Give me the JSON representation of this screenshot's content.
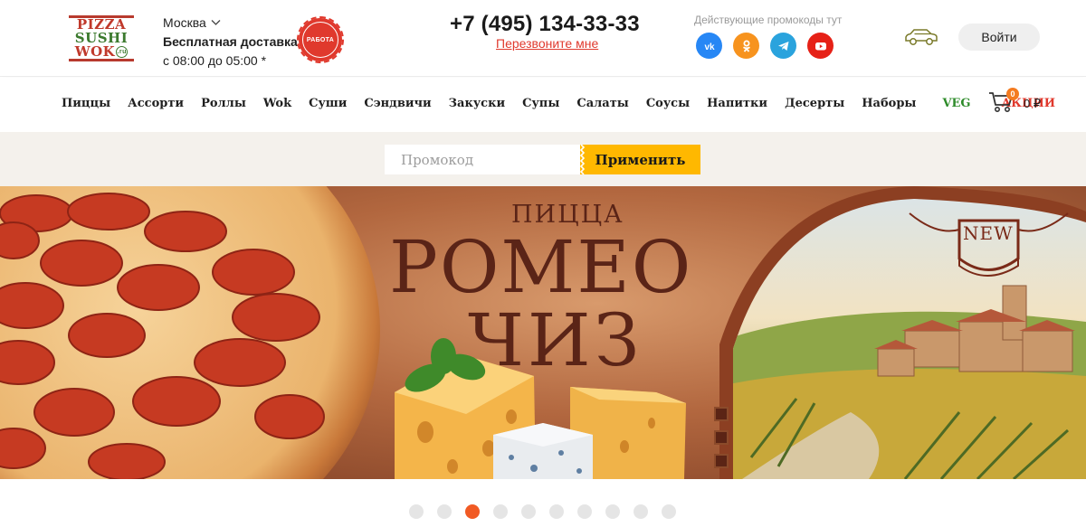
{
  "logo": {
    "line1": "PIZZA",
    "line2": "SUSHI",
    "line3": "WOK",
    "badge": ".ru"
  },
  "location": {
    "city": "Москва",
    "delivery": "Бесплатная доставка",
    "hours": "с 08:00 до 05:00 *"
  },
  "work_badge": "РАБОТА",
  "contact": {
    "phone": "+7 (495) 134-33-33",
    "callback": "Перезвоните мне"
  },
  "promo_note": "Действующие промокоды тут",
  "socials": [
    {
      "name": "vk-icon",
      "color": "#2787f5"
    },
    {
      "name": "ok-icon",
      "color": "#f7931e"
    },
    {
      "name": "telegram-icon",
      "color": "#2aa3dd"
    },
    {
      "name": "youtube-icon",
      "color": "#e62117"
    }
  ],
  "login_label": "Войти",
  "nav": {
    "items": [
      "Пиццы",
      "Ассорти",
      "Роллы",
      "Wok",
      "Суши",
      "Сэндвичи",
      "Закуски",
      "Супы",
      "Салаты",
      "Соусы",
      "Напитки",
      "Десерты",
      "Наборы",
      "VEG",
      "АКЦИИ"
    ],
    "veg_color": "#2e8b2a",
    "sale_color": "#e0392d"
  },
  "cart": {
    "count": "0",
    "total": "0 ₽"
  },
  "promo": {
    "placeholder": "Промокод",
    "button": "Применить",
    "button_color": "#ffb800"
  },
  "banner": {
    "subtitle": "ПИЦЦА",
    "title_line1": "РОМЕО",
    "title_line2": "ЧИЗ",
    "new_label": "NEW"
  },
  "slider": {
    "count": 10,
    "active_index": 2,
    "active_color": "#f15a24"
  },
  "colors": {
    "accent": "#e0392d",
    "brand_green": "#3c7a2e"
  }
}
